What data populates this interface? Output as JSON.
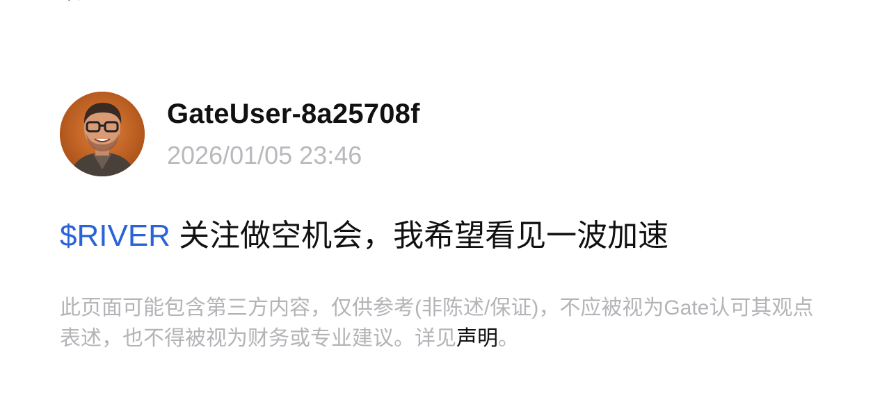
{
  "post": {
    "author": {
      "username": "GateUser-8a25708f",
      "timestamp": "2026/01/05 23:46"
    },
    "body": {
      "ticker": "$RIVER",
      "text": " 关注做空机会，我希望看见一波加速"
    },
    "disclaimer": {
      "text": "此页面可能包含第三方内容，仅供参考(非陈述/保证)，不应被视为Gate认可其观点表述，也不得被视为财务或专业建议。详见",
      "link_label": "声明",
      "suffix": "。"
    }
  },
  "colors": {
    "ticker": "#2a63d8",
    "timestamp": "#b9b9bd",
    "disclaimer": "#b4b4b8",
    "text": "#111111"
  }
}
